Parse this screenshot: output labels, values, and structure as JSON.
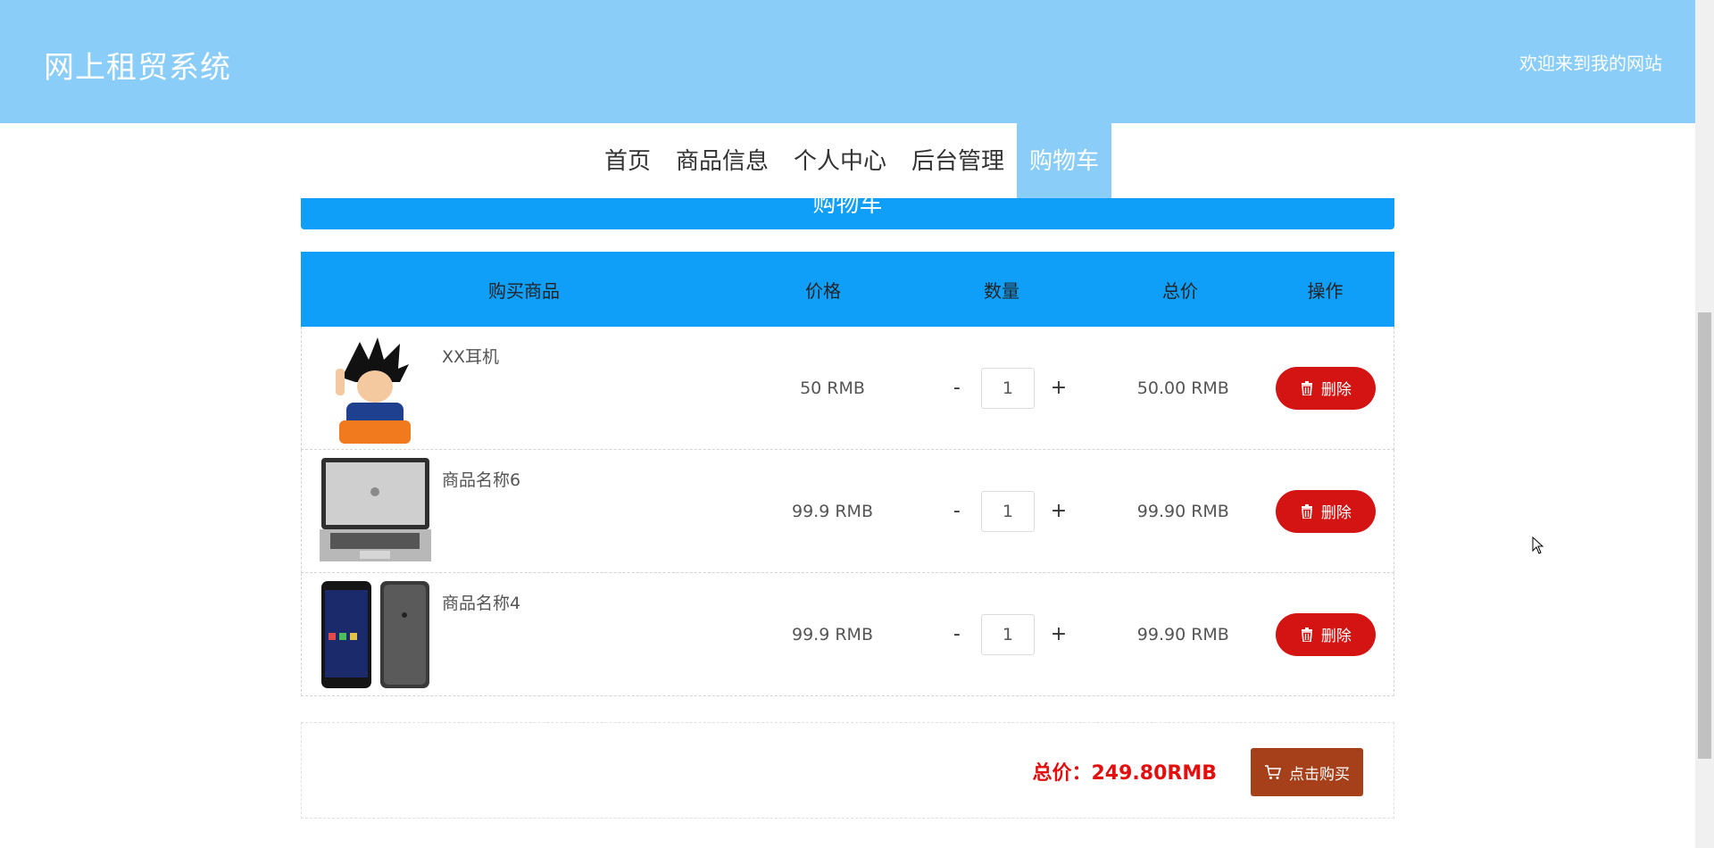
{
  "header": {
    "brand": "网上租贸系统",
    "welcome": "欢迎来到我的网站"
  },
  "nav": {
    "items": [
      {
        "label": "首页"
      },
      {
        "label": "商品信息"
      },
      {
        "label": "个人中心"
      },
      {
        "label": "后台管理"
      },
      {
        "label": "购物车",
        "active": true
      }
    ]
  },
  "banner": {
    "title": "购物车"
  },
  "table": {
    "headers": [
      "购买商品",
      "价格",
      "数量",
      "总价",
      "操作"
    ],
    "rows": [
      {
        "name": "XX耳机",
        "price": "50 RMB",
        "qty": "1",
        "total": "50.00 RMB",
        "delete_label": "删除",
        "minus": "-",
        "plus": "+"
      },
      {
        "name": "商品名称6",
        "price": "99.9 RMB",
        "qty": "1",
        "total": "99.90 RMB",
        "delete_label": "删除",
        "minus": "-",
        "plus": "+"
      },
      {
        "name": "商品名称4",
        "price": "99.9 RMB",
        "qty": "1",
        "total": "99.90 RMB",
        "delete_label": "删除",
        "minus": "-",
        "plus": "+"
      }
    ]
  },
  "summary": {
    "total_label": "总价：249.80RMB",
    "buy_label": "点击购买"
  },
  "colors": {
    "header_bg": "#89cdf8",
    "table_header_bg": "#0f9ff9",
    "delete_btn": "#d41313",
    "buy_btn": "#a6401b",
    "total_text": "#e30f0f"
  }
}
